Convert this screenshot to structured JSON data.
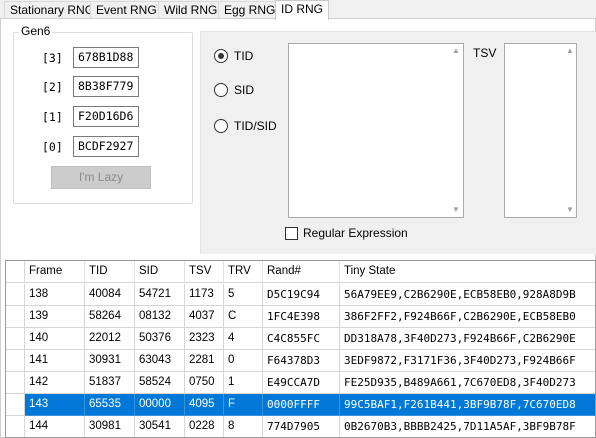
{
  "tabs": [
    {
      "label": "Stationary RNG",
      "active": false
    },
    {
      "label": "Event RNG",
      "active": false
    },
    {
      "label": "Wild RNG",
      "active": false
    },
    {
      "label": "Egg RNG",
      "active": false
    },
    {
      "label": "ID RNG",
      "active": true
    }
  ],
  "gen6": {
    "title": "Gen6",
    "seeds": [
      {
        "label": "[3]",
        "value": "678B1D88"
      },
      {
        "label": "[2]",
        "value": "8B38F779"
      },
      {
        "label": "[1]",
        "value": "F20D16D6"
      },
      {
        "label": "[0]",
        "value": "BCDF2927"
      }
    ],
    "lazy_button": "I'm Lazy"
  },
  "search": {
    "radios": [
      {
        "label": "TID",
        "checked": true
      },
      {
        "label": "SID",
        "checked": false
      },
      {
        "label": "TID/SID",
        "checked": false
      }
    ],
    "tsv_label": "TSV",
    "regex_label": "Regular Expression",
    "regex_checked": false
  },
  "grid": {
    "columns": [
      "Frame",
      "TID",
      "SID",
      "TSV",
      "TRV",
      "Rand#",
      "Tiny State"
    ],
    "rows": [
      [
        "138",
        "40084",
        "54721",
        "1173",
        "5",
        "D5C19C94",
        "56A79EE9,C2B6290E,ECB58EB0,928A8D9B"
      ],
      [
        "139",
        "58264",
        "08132",
        "4037",
        "C",
        "1FC4E398",
        "386F2FF2,F924B66F,C2B6290E,ECB58EB0"
      ],
      [
        "140",
        "22012",
        "50376",
        "2323",
        "4",
        "C4C855FC",
        "DD318A78,3F40D273,F924B66F,C2B6290E"
      ],
      [
        "141",
        "30931",
        "63043",
        "2281",
        "0",
        "F64378D3",
        "3EDF9872,F3171F36,3F40D273,F924B66F"
      ],
      [
        "142",
        "51837",
        "58524",
        "0750",
        "1",
        "E49CCA7D",
        "FE25D935,B489A661,7C670ED8,3F40D273"
      ],
      [
        "143",
        "65535",
        "00000",
        "4095",
        "F",
        "0000FFFF",
        "99C5BAF1,F261B441,3BF9B78F,7C670ED8"
      ],
      [
        "144",
        "30981",
        "30541",
        "0228",
        "8",
        "774D7905",
        "0B2670B3,BBBB2425,7D11A5AF,3BF9B78F"
      ]
    ],
    "selected_frame": "143",
    "selection_color": "#0078d7"
  }
}
